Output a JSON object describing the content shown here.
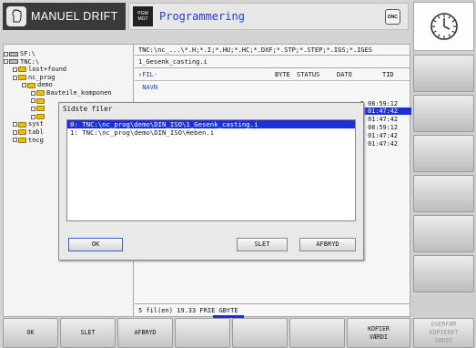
{
  "header": {
    "mode_title": "MANUEL DRIFT",
    "pgm_icon_line1": "PGM",
    "pgm_icon_line2": "MGT",
    "program_title": "Programmering",
    "dnc_label": "DNC"
  },
  "tree": {
    "items": [
      "SF:\\",
      "TNC:\\",
      "lost+found",
      "nc_prog",
      "demo",
      "Bauteile_komponen",
      "",
      "",
      "",
      "syst",
      "tabl",
      "tncg"
    ]
  },
  "file_pane": {
    "filter": "TNC:\\nc_...\\*.H;*.I;*.HU;*.HC;*.DXF;*.STP;*.STEP;*.IGS;*.IGES",
    "selected_file": "1_Gesenk_casting.i",
    "columns": [
      "FIL-NAVN",
      "BYTE",
      "STATUS",
      "DATO",
      "TID"
    ],
    "times": [
      "5 08:59:12",
      "5 01:47:42",
      "5 01:47:42",
      "5 08:59:12",
      "5 01:47:42",
      "5 01:47:42"
    ],
    "status": "5   fil(en)  19.33 FRIE GBYTE"
  },
  "dialog": {
    "title": "Sidste filer",
    "items": [
      "0: TNC:\\nc_prog\\demo\\DIN_ISO\\1_Gesenk_casting.i",
      "1: TNC:\\nc_prog\\demo\\DIN_ISO\\Heben.i"
    ],
    "ok_label": "OK",
    "delete_label": "SLET",
    "cancel_label": "AFBRYD"
  },
  "softkeys": {
    "bottom": [
      {
        "label": "OK",
        "enabled": true
      },
      {
        "label": "SLET",
        "enabled": true
      },
      {
        "label": "AFBRYD",
        "enabled": true
      },
      {
        "label": "",
        "enabled": true
      },
      {
        "label": "",
        "enabled": true
      },
      {
        "label": "",
        "enabled": true
      },
      {
        "label": "KOPIER\nVÆRDI",
        "enabled": true
      },
      {
        "label": "OVERFØR\nKOPIERET\nVÆRDI",
        "enabled": false
      }
    ]
  },
  "colors": {
    "selection": "#1d2fd6",
    "title_blue": "#1e3bd0",
    "header_dark": "#3a3a3a"
  }
}
